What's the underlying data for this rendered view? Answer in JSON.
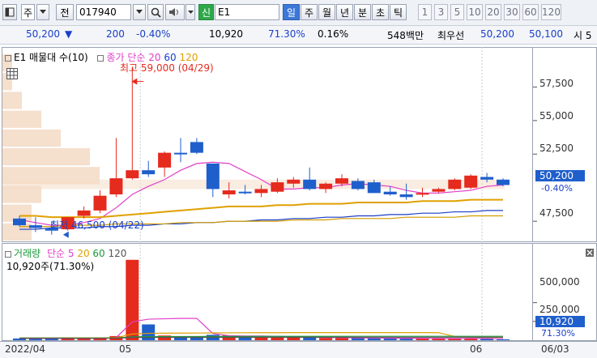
{
  "toolbar": {
    "market": "주",
    "jeon": "전",
    "code": "017940",
    "search_glyph": "Q",
    "shin": "신",
    "name": "E1",
    "tabs": [
      "일",
      "주",
      "월",
      "년",
      "분",
      "초",
      "틱"
    ],
    "selected_tab": "일",
    "periods": [
      "1",
      "3",
      "5",
      "10",
      "20",
      "30",
      "60",
      "120"
    ]
  },
  "info": {
    "price": "50,200",
    "down_arrow": "▼",
    "change": "200",
    "change_pct": "-0.40%",
    "volume": "10,920",
    "vol_ratio": "71.30%",
    "turnover": "0.16%",
    "amount": "548백만",
    "best_quote_label": "최우선",
    "ask": "50,200",
    "bid": "50,100",
    "trailing": "시 5"
  },
  "price_panel": {
    "legend_title": "E1 매물대 수(10)",
    "legend_ma": "종가 단순",
    "legend_ma_periods": [
      "20",
      "60",
      "120"
    ],
    "high_label": "최고 59,000 (04/29)",
    "low_label": "최저 46,500 (04/22)",
    "y_ticks": [
      "57,500",
      "55,000",
      "52,500",
      "47,500"
    ],
    "current_price": "50,200",
    "current_pct": "-0.40%"
  },
  "volume_panel": {
    "legend_title": "거래량",
    "legend_ma": "단순 5",
    "legend_ma_periods": [
      "20",
      "60",
      "120"
    ],
    "current_label": "10,920주(71.30%)",
    "y_ticks": [
      "500,000",
      "250,000"
    ],
    "current_volume": "10,920",
    "current_pct": "71.30%"
  },
  "x_axis": {
    "labels": [
      "2022/04",
      "05",
      "06",
      "06/03"
    ]
  },
  "colors": {
    "up": "#e52a1e",
    "down": "#1f5fcc",
    "ma5": "#e040c8",
    "ma20": "#e0a000",
    "ma60": "#1a9b3a",
    "ma120": "#1a3fc7",
    "volume_profile": "#f4dcc8"
  },
  "chart_data": {
    "type": "candlestick",
    "dates": [
      "04/20",
      "04/21",
      "04/22",
      "04/25",
      "04/26",
      "04/27",
      "04/28",
      "04/29",
      "05/02",
      "05/03",
      "05/04",
      "05/06",
      "05/09",
      "05/10",
      "05/11",
      "05/12",
      "05/13",
      "05/16",
      "05/17",
      "05/18",
      "05/19",
      "05/20",
      "05/23",
      "05/24",
      "05/25",
      "05/26",
      "05/27",
      "05/30",
      "05/31",
      "06/02",
      "06/03"
    ],
    "open": [
      47700,
      47200,
      47000,
      46900,
      47900,
      48300,
      49500,
      50700,
      51300,
      51500,
      52600,
      53400,
      51800,
      49500,
      49700,
      49600,
      49700,
      50300,
      50600,
      49900,
      50300,
      50500,
      50400,
      49700,
      49500,
      49600,
      49700,
      49900,
      50000,
      50800,
      50600
    ],
    "high": [
      47900,
      47800,
      47500,
      47800,
      48600,
      49800,
      53700,
      59000,
      52000,
      52700,
      53700,
      53700,
      51800,
      50400,
      50200,
      50200,
      50700,
      50800,
      51500,
      50400,
      51000,
      50700,
      50600,
      50100,
      50300,
      50000,
      50000,
      50700,
      51000,
      51100,
      50700
    ],
    "low": [
      47100,
      46700,
      46500,
      46800,
      47700,
      48100,
      49300,
      50600,
      50800,
      50800,
      51900,
      52500,
      49300,
      49200,
      49500,
      49300,
      49600,
      50000,
      49800,
      49600,
      50100,
      49800,
      49600,
      49400,
      49100,
      49300,
      49600,
      49800,
      49900,
      50400,
      50100
    ],
    "close": [
      47200,
      47000,
      46800,
      47800,
      48300,
      49400,
      50700,
      51300,
      51000,
      52600,
      52500,
      52600,
      49900,
      49800,
      49600,
      49900,
      50400,
      50600,
      49900,
      50300,
      50700,
      49900,
      49600,
      49500,
      49300,
      49600,
      49900,
      50600,
      50900,
      50600,
      50200
    ],
    "volume": [
      22000,
      18000,
      17000,
      38000,
      30000,
      28000,
      55000,
      1070000,
      210000,
      62000,
      48000,
      52000,
      71000,
      64000,
      47000,
      39000,
      40000,
      38000,
      33000,
      30000,
      28000,
      27000,
      26000,
      22000,
      25000,
      24000,
      21000,
      23000,
      27000,
      22000,
      10920
    ],
    "ma_price": {
      "5": [
        47600,
        47400,
        47200,
        47200,
        47400,
        47700,
        48500,
        49500,
        50100,
        50600,
        51300,
        51800,
        51900,
        51800,
        51200,
        50600,
        49900,
        49900,
        50000,
        50000,
        50200,
        50300,
        50200,
        50100,
        49800,
        49600,
        49600,
        49700,
        49800,
        50100,
        50200
      ],
      "20": [
        47900,
        47900,
        47800,
        47800,
        47800,
        47800,
        47900,
        48000,
        48100,
        48200,
        48300,
        48400,
        48500,
        48600,
        48600,
        48600,
        48700,
        48700,
        48800,
        48800,
        48800,
        48900,
        48900,
        48900,
        48900,
        49000,
        49000,
        49000,
        49100,
        49100,
        49100
      ],
      "60": [
        46900,
        46900,
        47000,
        47000,
        47000,
        47100,
        47100,
        47200,
        47200,
        47300,
        47300,
        47400,
        47400,
        47500,
        47500,
        47600,
        47600,
        47700,
        47700,
        47800,
        47800,
        47900,
        47900,
        48000,
        48000,
        48100,
        48100,
        48200,
        48200,
        48300,
        48300
      ],
      "120": [
        47100,
        47100,
        47100,
        47200,
        47200,
        47200,
        47300,
        47300,
        47300,
        47300,
        47400,
        47400,
        47400,
        47500,
        47500,
        47500,
        47500,
        47600,
        47600,
        47600,
        47700,
        47700,
        47700,
        47700,
        47800,
        47800,
        47800,
        47800,
        47900,
        47900,
        47900
      ]
    },
    "ma_volume": {
      "5": [
        25000,
        24000,
        22000,
        25000,
        26000,
        26000,
        34000,
        245000,
        280000,
        285000,
        290000,
        290000,
        88000,
        60000,
        56000,
        55000,
        52000,
        45000,
        39000,
        36000,
        34000,
        31000,
        29000,
        27000,
        26000,
        25000,
        24000,
        23000,
        24000,
        23000,
        21000
      ],
      "20": [
        30000,
        30000,
        30000,
        31000,
        31000,
        31000,
        32000,
        82000,
        91000,
        93000,
        94000,
        95000,
        97000,
        98000,
        99000,
        100000,
        100000,
        101000,
        101000,
        101000,
        101000,
        101000,
        101000,
        101000,
        101000,
        101000,
        100000,
        49000,
        40000,
        38000,
        37000
      ],
      "60": [
        28000,
        28000,
        28000,
        28000,
        28000,
        28000,
        29000,
        45000,
        48000,
        48000,
        49000,
        49000,
        50000,
        50000,
        50000,
        51000,
        51000,
        51000,
        51000,
        51000,
        51000,
        52000,
        52000,
        52000,
        52000,
        52000,
        52000,
        52000,
        52000,
        52000,
        52000
      ],
      "120": [
        26000,
        26000,
        26000,
        26000,
        26000,
        26000,
        27000,
        35000,
        37000,
        37000,
        38000,
        38000,
        38000,
        38000,
        39000,
        39000,
        39000,
        39000,
        39000,
        39000,
        40000,
        40000,
        40000,
        40000,
        40000,
        40000,
        40000,
        40000,
        40000,
        40000,
        40000
      ]
    },
    "volume_profile": [
      3,
      3,
      4,
      10,
      9,
      6,
      4,
      2,
      1,
      1
    ],
    "price_ylim": [
      46000,
      60000
    ],
    "volume_ylim": [
      0,
      1100000
    ]
  }
}
